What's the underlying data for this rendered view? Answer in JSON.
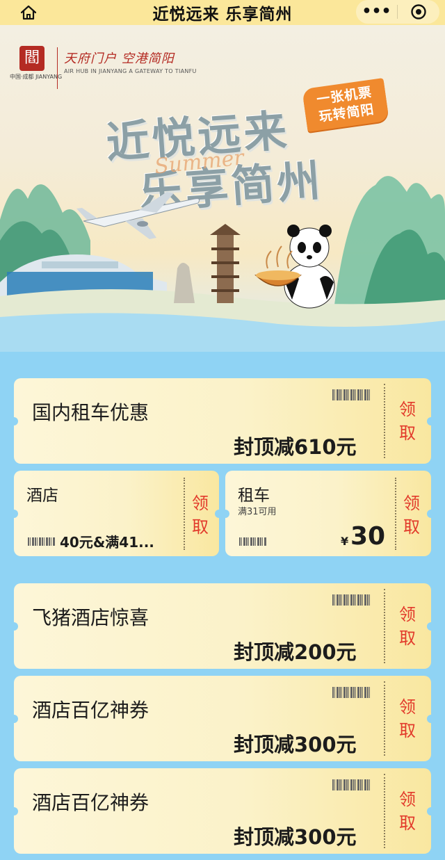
{
  "nav": {
    "title": "近悦远来 乐享简州",
    "more": "•••"
  },
  "banner": {
    "logo_seal": "閻",
    "logo_caption": "中国·成都 JIANYANG",
    "slogan_cn": "天府门户 空港简阳",
    "slogan_en": "AIR HUB IN JIANYANG A GATEWAY TO TIANFU",
    "badge_line1": "一张机票",
    "badge_line2": "玩转简阳",
    "title_line1": "近悦远来",
    "title_line2": "乐享简州",
    "script_word": "Summer"
  },
  "coupons": [
    {
      "name": "国内租车优惠",
      "value": "封顶减610元",
      "claim": [
        "领",
        "取"
      ]
    },
    {
      "name": "飞猪酒店惊喜",
      "value": "封顶减200元",
      "claim": [
        "领",
        "取"
      ]
    },
    {
      "name": "酒店百亿神券",
      "value": "封顶减300元",
      "claim": [
        "领",
        "取"
      ]
    },
    {
      "name": "酒店百亿神券",
      "value": "封顶减300元",
      "claim": [
        "领",
        "取"
      ]
    }
  ],
  "small_coupons": [
    {
      "name": "酒店",
      "value": "40元&满41...",
      "claim": [
        "领",
        "取"
      ]
    },
    {
      "name": "租车",
      "condition": "满31可用",
      "currency": "¥",
      "amount": "30",
      "claim": [
        "领",
        "取"
      ]
    }
  ],
  "colors": {
    "nav_bg": "#fbe79a",
    "page_bg": "#8fd3f4",
    "claim_red": "#e23a2b",
    "badge_orange": "#f08a2e"
  }
}
